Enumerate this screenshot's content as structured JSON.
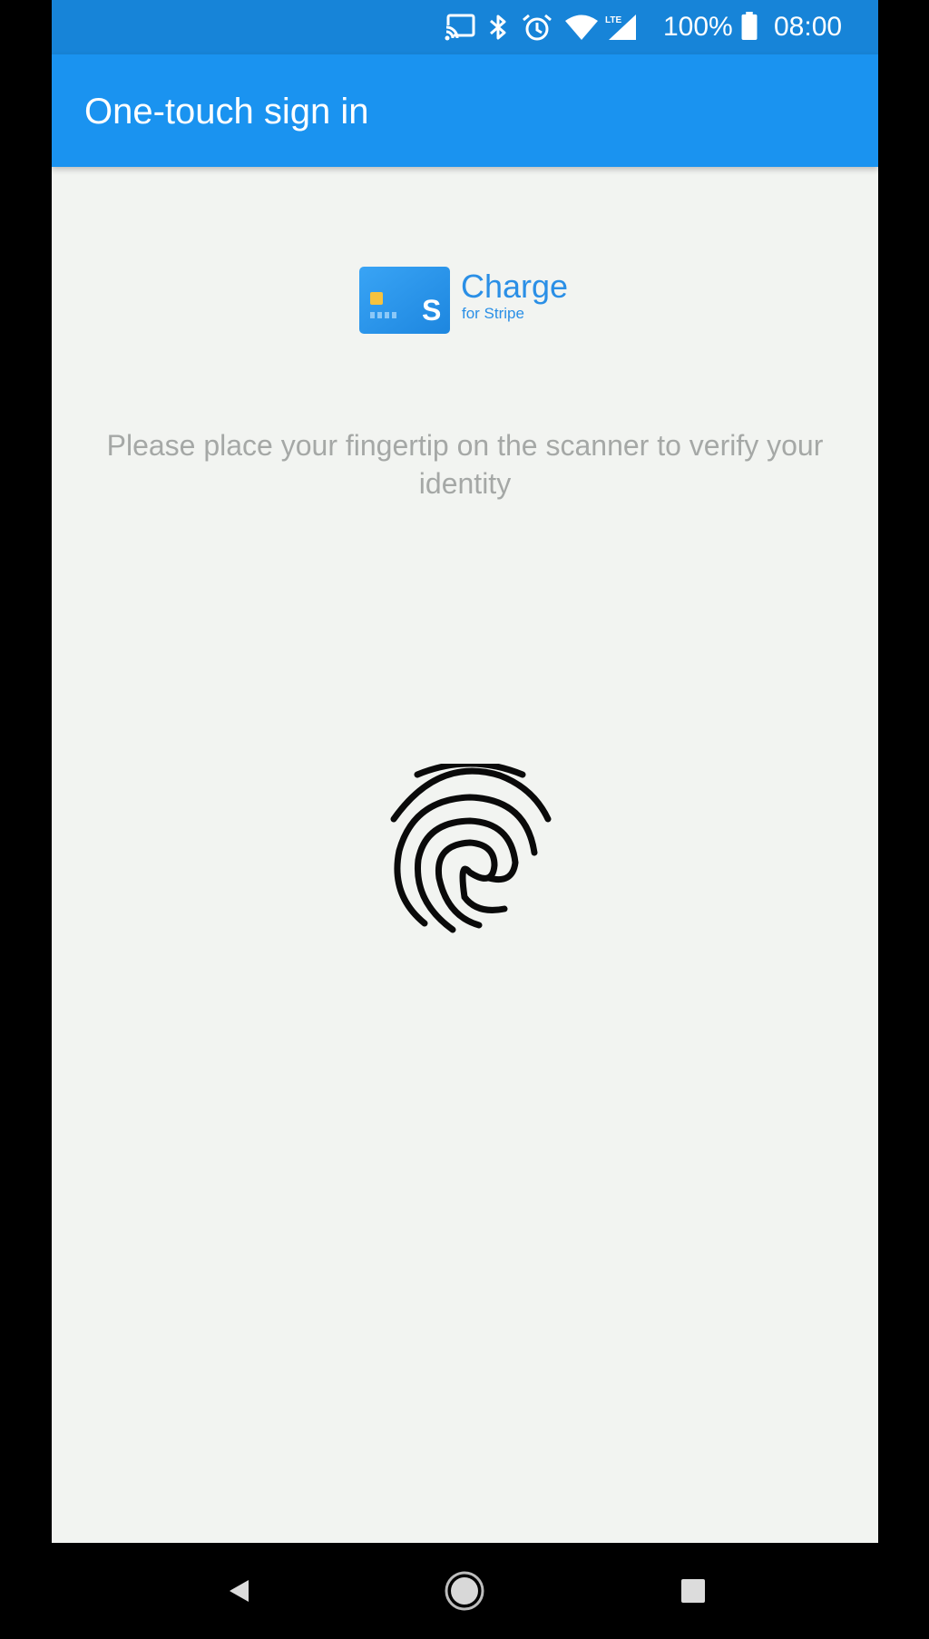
{
  "status_bar": {
    "icons": [
      "cast-icon",
      "bluetooth-icon",
      "alarm-icon",
      "wifi-icon",
      "lte-signal-icon",
      "battery-icon"
    ],
    "network_label": "LTE",
    "battery": "100%",
    "time": "08:00"
  },
  "app_bar": {
    "title": "One-touch sign in"
  },
  "logo": {
    "name": "Charge",
    "subtitle": "for Stripe",
    "card_letter": "S"
  },
  "main": {
    "instruction": "Please place your fingertip on the scanner to verify your identity",
    "icon": "fingerprint-icon"
  },
  "nav_bar": {
    "buttons": [
      "back-icon",
      "home-icon",
      "recents-icon"
    ]
  },
  "colors": {
    "status_bar": "#1784d8",
    "app_bar": "#1a93f0",
    "background": "#f2f4f1",
    "brand": "#2a8fe6",
    "instruction_text": "#a5a8a6",
    "chip": "#f6c23e"
  }
}
